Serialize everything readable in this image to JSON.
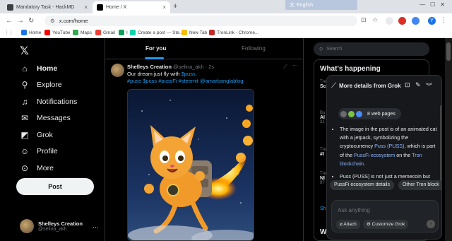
{
  "browser": {
    "tabs": [
      {
        "label": "Mandatory Task - HackMD",
        "close": "×"
      },
      {
        "label": "Home / X",
        "close": "×"
      }
    ],
    "new_tab": "+",
    "translate_popup": {
      "lang": "English"
    },
    "url": "x.com/home",
    "profile_letter": "Y",
    "bookmarks": [
      "Home",
      "YouTube",
      "Maps",
      "Gmail",
      "I",
      "Create a post — Ste...",
      "New Tab",
      "TronLink - Chrome..."
    ]
  },
  "sidebar": {
    "logo": "𝕏",
    "items": [
      {
        "label": "Home"
      },
      {
        "label": "Explore"
      },
      {
        "label": "Notifications"
      },
      {
        "label": "Messages"
      },
      {
        "label": "Grok"
      },
      {
        "label": "Profile"
      },
      {
        "label": "More"
      }
    ],
    "post_label": "Post",
    "profile": {
      "name": "Shelleys Creation",
      "handle": "@selina_akh",
      "more": "···"
    }
  },
  "feed": {
    "tabs": [
      {
        "label": "For you"
      },
      {
        "label": "Following"
      }
    ],
    "post": {
      "name": "Shelleys Creation",
      "meta": "@selina_akh · 2s",
      "text_prefix": "Our dream just fly with ",
      "text_link": "$puss.",
      "hashtags": "#puss $puss #pussFi #steemit @amarbanglablog",
      "more": "···"
    }
  },
  "right": {
    "search_placeholder": "Search",
    "happening_title": "What's happening",
    "trend_fragments": [
      {
        "top": "Tre",
        "bold": "Sc"
      },
      {
        "top": "Bu",
        "bold": "AI"
      },
      {
        "top": "31",
        "bold": ""
      },
      {
        "top": "Tre",
        "bold": "#I"
      },
      {
        "top": "Tre",
        "bold": "NI"
      },
      {
        "top": "97",
        "bold": ""
      }
    ],
    "show_more_fragment": "Sh",
    "wh_fragment": "W"
  },
  "grok_panel": {
    "title": "More details from Grok",
    "sources_label": "8 web pages",
    "bullet1": {
      "a": "The image in the post is of an animated cat with a jetpack, symbolizing the cryptocurrency ",
      "puss": "Puss (PUSS)",
      "b": ", which is part of the ",
      "eco": "PussFi ecosystem",
      "c": " on the ",
      "tron": "Tron blockchain",
      "d": "."
    },
    "bullet2": {
      "a": "Puss (PUSS) is not just a memecoin but",
      "b": "be"
    },
    "chips": [
      "PussFi ecosystem details",
      "Other Tron block"
    ],
    "input_placeholder": "Ask anything",
    "attach": "Attach",
    "customize": "Customize Grok",
    "colors": {
      "link": "#1d9bf0",
      "accent_bg": "#16181c"
    }
  }
}
